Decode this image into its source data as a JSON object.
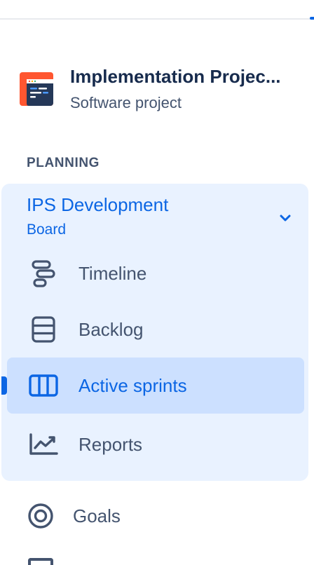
{
  "project": {
    "name": "Implementation Projec...",
    "type": "Software project",
    "avatar_icon": "project-avatar-icon"
  },
  "planning": {
    "heading": "PLANNING",
    "board": {
      "name": "IPS Development",
      "type": "Board",
      "expand_icon": "chevron-down-icon"
    },
    "items": [
      {
        "label": "Timeline",
        "icon": "timeline-icon",
        "active": false
      },
      {
        "label": "Backlog",
        "icon": "backlog-icon",
        "active": false
      },
      {
        "label": "Active sprints",
        "icon": "board-columns-icon",
        "active": true
      },
      {
        "label": "Reports",
        "icon": "chart-line-icon",
        "active": false
      }
    ]
  },
  "goals": {
    "label": "Goals",
    "icon": "target-icon"
  },
  "colors": {
    "accent": "#0c66e4",
    "panel_bg": "#e9f2ff",
    "active_bg": "#cce0ff",
    "text": "#44546f",
    "heading": "#172b4d"
  }
}
